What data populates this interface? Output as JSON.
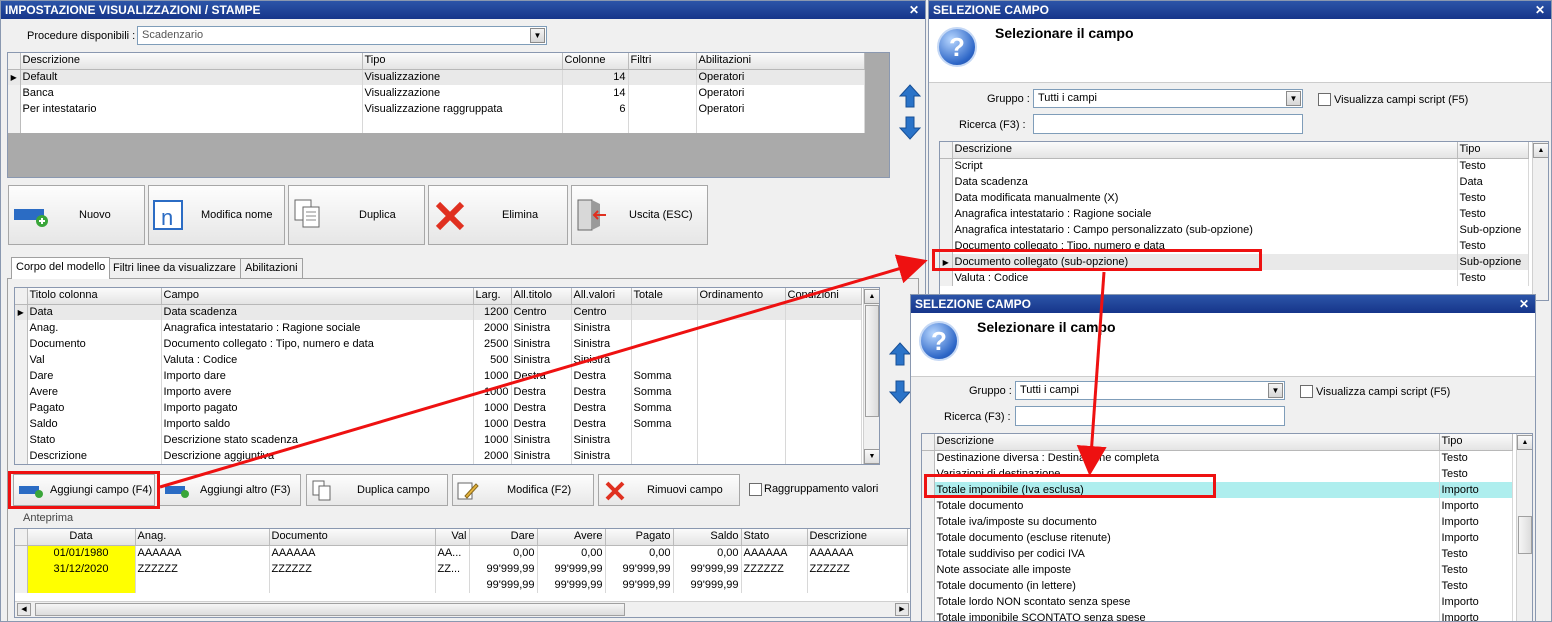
{
  "main": {
    "title": "IMPOSTAZIONE VISUALIZZAZIONI / STAMPE",
    "procedure_label": "Procedure disponibili :",
    "procedure_value": "Scadenzario",
    "proc_columns": [
      "Descrizione",
      "Tipo",
      "Colonne",
      "Filtri",
      "Abilitazioni"
    ],
    "proc_rows": [
      {
        "desc": "Default",
        "tipo": "Visualizzazione",
        "colonne": "14",
        "filtri": "",
        "abil": "Operatori"
      },
      {
        "desc": "Banca",
        "tipo": "Visualizzazione",
        "colonne": "14",
        "filtri": "",
        "abil": "Operatori"
      },
      {
        "desc": "Per intestatario",
        "tipo": "Visualizzazione raggruppata",
        "colonne": "6",
        "filtri": "",
        "abil": "Operatori"
      }
    ],
    "buttons": {
      "nuovo": "Nuovo",
      "modifica_nome": "Modifica nome",
      "duplica": "Duplica",
      "elimina": "Elimina",
      "uscita": "Uscita (ESC)"
    },
    "tabs": [
      "Corpo del modello",
      "Filtri linee da visualizzare",
      "Abilitazioni"
    ],
    "col_columns": [
      "Titolo colonna",
      "Campo",
      "Larg.",
      "All.titolo",
      "All.valori",
      "Totale",
      "Ordinamento",
      "Condizioni"
    ],
    "col_rows": [
      {
        "titolo": "Data",
        "campo": "Data scadenza",
        "larg": "1200",
        "alltit": "Centro",
        "allval": "Centro",
        "tot": ""
      },
      {
        "titolo": "Anag.",
        "campo": "Anagrafica intestatario : Ragione sociale",
        "larg": "2000",
        "alltit": "Sinistra",
        "allval": "Sinistra",
        "tot": ""
      },
      {
        "titolo": "Documento",
        "campo": "Documento collegato : Tipo, numero e data",
        "larg": "2500",
        "alltit": "Sinistra",
        "allval": "Sinistra",
        "tot": ""
      },
      {
        "titolo": "Val",
        "campo": "Valuta : Codice",
        "larg": "500",
        "alltit": "Sinistra",
        "allval": "Sinistra",
        "tot": ""
      },
      {
        "titolo": "Dare",
        "campo": "Importo dare",
        "larg": "1000",
        "alltit": "Destra",
        "allval": "Destra",
        "tot": "Somma"
      },
      {
        "titolo": "Avere",
        "campo": "Importo avere",
        "larg": "1000",
        "alltit": "Destra",
        "allval": "Destra",
        "tot": "Somma"
      },
      {
        "titolo": "Pagato",
        "campo": "Importo pagato",
        "larg": "1000",
        "alltit": "Destra",
        "allval": "Destra",
        "tot": "Somma"
      },
      {
        "titolo": "Saldo",
        "campo": "Importo saldo",
        "larg": "1000",
        "alltit": "Destra",
        "allval": "Destra",
        "tot": "Somma"
      },
      {
        "titolo": "Stato",
        "campo": "Descrizione stato scadenza",
        "larg": "1000",
        "alltit": "Sinistra",
        "allval": "Sinistra",
        "tot": ""
      },
      {
        "titolo": "Descrizione",
        "campo": "Descrizione aggiuntiva",
        "larg": "2000",
        "alltit": "Sinistra",
        "allval": "Sinistra",
        "tot": ""
      }
    ],
    "buttons2": {
      "aggiungi_campo": "Aggiungi campo (F4)",
      "aggiungi_altro": "Aggiungi altro (F3)",
      "duplica_campo": "Duplica campo",
      "modifica": "Modifica (F2)",
      "rimuovi": "Rimuovi campo",
      "raggruppamento": "Raggruppamento valori"
    },
    "anteprima_label": "Anteprima",
    "prev_columns": [
      "Data",
      "Anag.",
      "Documento",
      "Val",
      "Dare",
      "Avere",
      "Pagato",
      "Saldo",
      "Stato",
      "Descrizione"
    ],
    "prev_rows": [
      [
        "01/01/1980",
        "AAAAAA",
        "AAAAAA",
        "AA...",
        "0,00",
        "0,00",
        "0,00",
        "0,00",
        "AAAAAA",
        "AAAAAA"
      ],
      [
        "31/12/2020",
        "ZZZZZZ",
        "ZZZZZZ",
        "ZZ...",
        "99'999,99",
        "99'999,99",
        "99'999,99",
        "99'999,99",
        "ZZZZZZ",
        "ZZZZZZ"
      ],
      [
        "",
        "",
        "",
        "",
        "99'999,99",
        "99'999,99",
        "99'999,99",
        "99'999,99",
        "",
        ""
      ]
    ],
    "highlight_color": "#ffff00"
  },
  "sel1": {
    "title": "SELEZIONE CAMPO",
    "heading": "Selezionare il campo",
    "gruppo_label": "Gruppo :",
    "gruppo_value": "Tutti i campi",
    "script_label": "Visualizza campi script (F5)",
    "ricerca_label": "Ricerca (F3) :",
    "columns": [
      "Descrizione",
      "Tipo"
    ],
    "rows": [
      [
        "Script",
        "Testo"
      ],
      [
        "Data scadenza",
        "Data"
      ],
      [
        "Data modificata manualmente (X)",
        "Testo"
      ],
      [
        "Anagrafica intestatario : Ragione sociale",
        "Testo"
      ],
      [
        "Anagrafica intestatario : Campo personalizzato (sub-opzione)",
        "Sub-opzione"
      ],
      [
        "Documento collegato : Tipo, numero e data",
        "Testo"
      ],
      [
        "Documento collegato (sub-opzione)",
        "Sub-opzione"
      ],
      [
        "Valuta : Codice",
        "Testo"
      ]
    ]
  },
  "sel2": {
    "title": "SELEZIONE CAMPO",
    "heading": "Selezionare il campo",
    "gruppo_label": "Gruppo :",
    "gruppo_value": "Tutti i campi",
    "script_label": "Visualizza campi script (F5)",
    "ricerca_label": "Ricerca (F3) :",
    "columns": [
      "Descrizione",
      "Tipo"
    ],
    "rows": [
      [
        "Destinazione diversa : Destinazione completa",
        "Testo"
      ],
      [
        "Variazioni di destinazione",
        "Testo"
      ],
      [
        "Totale imponibile (Iva esclusa)",
        "Importo"
      ],
      [
        "Totale documento",
        "Importo"
      ],
      [
        "Totale iva/imposte su documento",
        "Importo"
      ],
      [
        "Totale documento (escluse ritenute)",
        "Importo"
      ],
      [
        "Totale suddiviso per codici IVA",
        "Testo"
      ],
      [
        "Note associate alle imposte",
        "Testo"
      ],
      [
        "Totale documento (in lettere)",
        "Testo"
      ],
      [
        "Totale lordo NON scontato senza spese",
        "Importo"
      ],
      [
        "Totale imponibile SCONTATO senza spese",
        "Importo"
      ]
    ],
    "selected_color": "#aeeeee"
  },
  "annotation_color": "#ee1111"
}
